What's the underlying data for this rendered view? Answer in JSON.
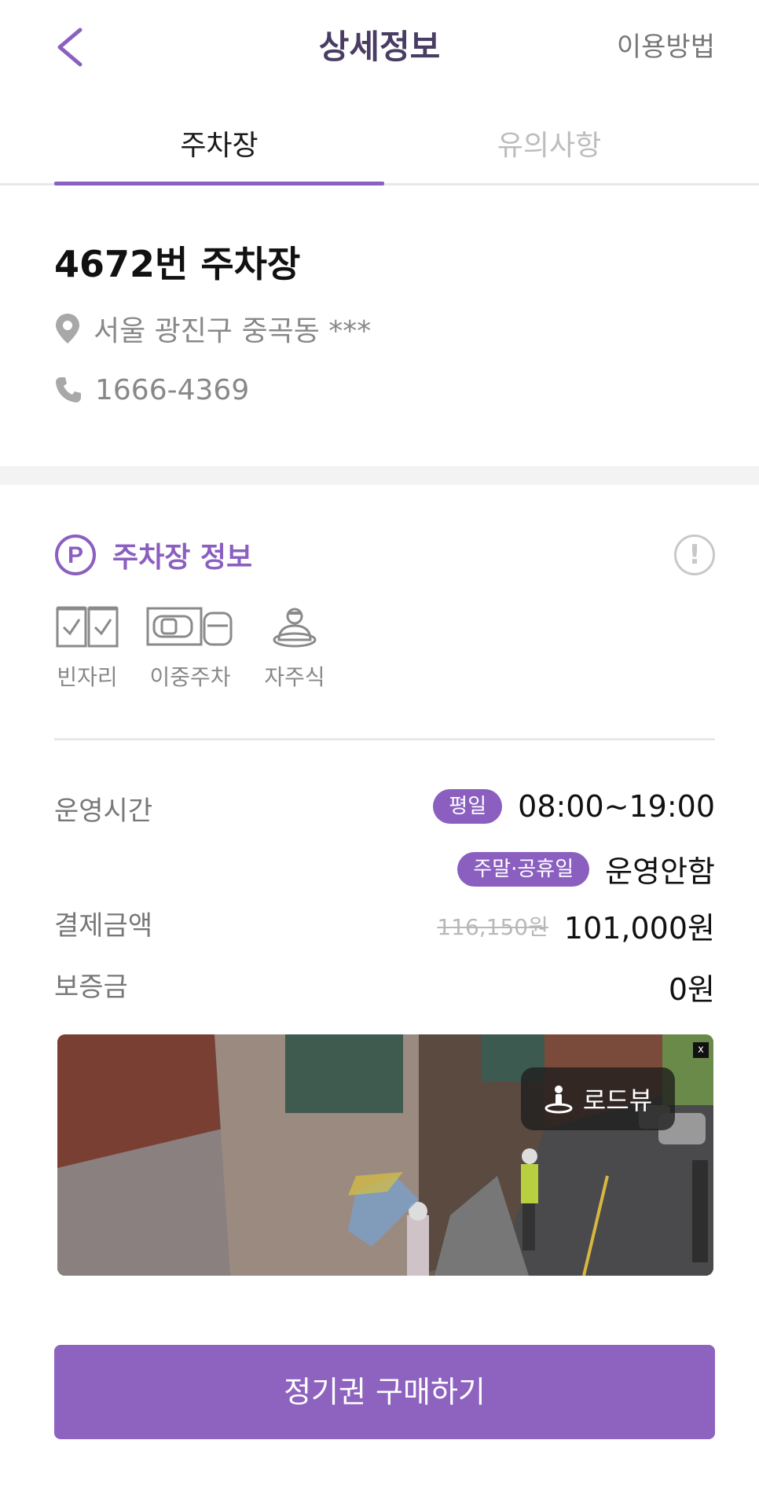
{
  "header": {
    "title": "상세정보",
    "help_label": "이용방법"
  },
  "tabs": [
    {
      "label": "주차장",
      "active": true
    },
    {
      "label": "유의사항",
      "active": false
    }
  ],
  "lot": {
    "name": "4672번 주차장",
    "address": "서울 광진구 중곡동 ***",
    "phone": "1666-4369"
  },
  "section": {
    "icon_letter": "P",
    "title": "주차장 정보",
    "info_icon": "!"
  },
  "features": [
    {
      "label": "빈자리",
      "icon": "checkbox-slots-icon"
    },
    {
      "label": "이중주차",
      "icon": "double-parking-icon"
    },
    {
      "label": "자주식",
      "icon": "self-parking-driver-icon"
    }
  ],
  "details": {
    "hours_label": "운영시간",
    "weekday_badge": "평일",
    "weekday_hours": "08:00~19:00",
    "weekend_badge": "주말·공휴일",
    "weekend_hours": "운영안함",
    "price_label": "결제금액",
    "price_original": "116,150원",
    "price": "101,000원",
    "deposit_label": "보증금",
    "deposit": "0원"
  },
  "roadview": {
    "label": "로드뷰",
    "close": "x"
  },
  "cta": {
    "label": "정기권 구매하기"
  },
  "colors": {
    "accent": "#8a5fc0",
    "title": "#4a3d63",
    "muted": "#888888",
    "divider": "#e8e8e8"
  }
}
